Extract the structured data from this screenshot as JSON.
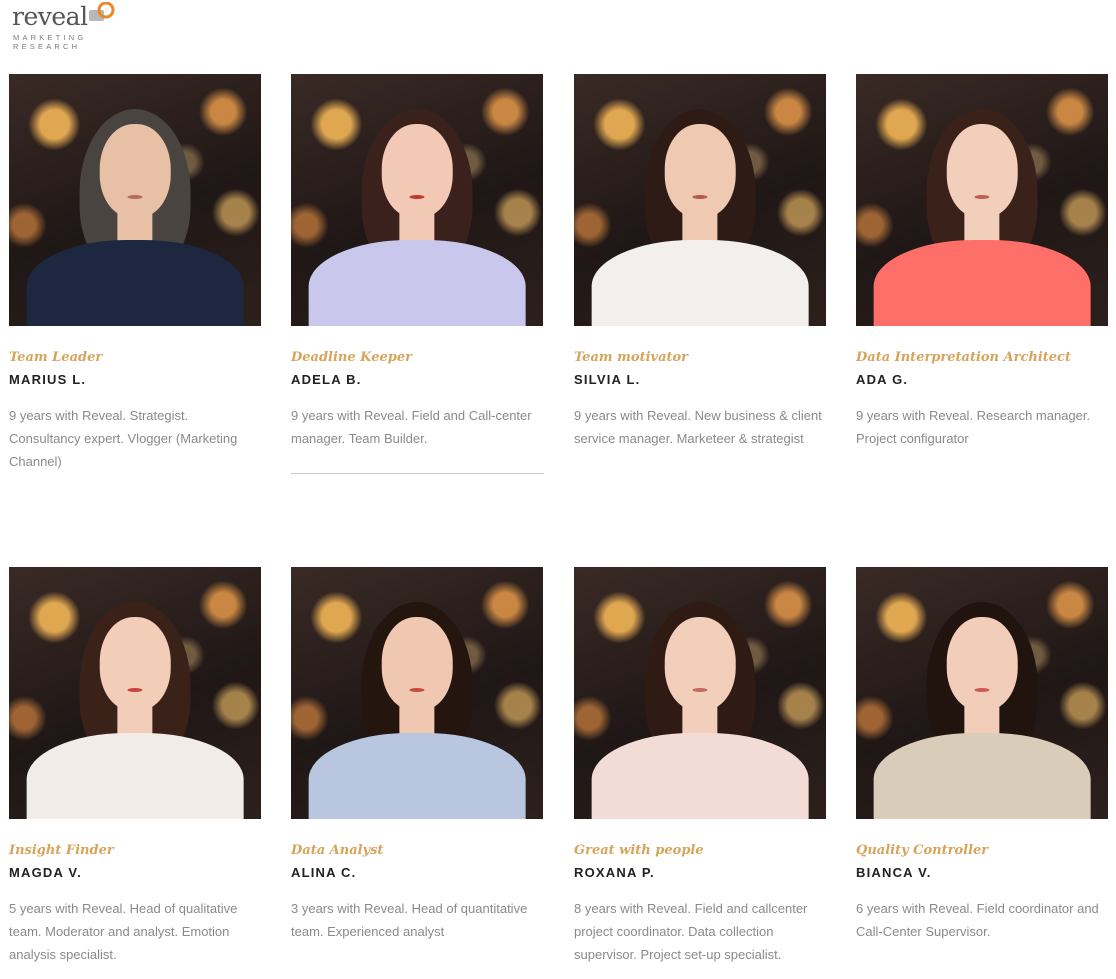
{
  "brand": {
    "name": "reveal",
    "tagline_line1": "MARKETING",
    "tagline_line2": "RESEARCH",
    "accent": "#d7a45b",
    "logo_orange": "#e8892b",
    "logo_grey": "#b8b8b8"
  },
  "team": [
    {
      "role": "Team Leader",
      "name": "MARIUS L.",
      "description": "9 years with Reveal. Strategist. Consultancy expert. Vlogger (Marketing Channel)",
      "photo": {
        "hair": "#4a4440",
        "body": "#1d2740",
        "skin": "#e8c0a6",
        "lips": "#b86b5a"
      }
    },
    {
      "role": "Deadline Keeper",
      "name": "ADELA B.",
      "description": "9 years with Reveal. Field and Call-center manager. Team Builder.",
      "photo": {
        "hair": "#3a211b",
        "body": "#c9c8ec",
        "skin": "#f1c9b4",
        "lips": "#c0392b"
      }
    },
    {
      "role": "Team motivator",
      "name": "SILVIA L.",
      "description": "9 years with Reveal. New business & client service manager. Marketeer & strategist",
      "photo": {
        "hair": "#2e1b15",
        "body": "#f3efec",
        "skin": "#f0c9b3",
        "lips": "#b55a4a"
      }
    },
    {
      "role": "Data Interpretation Architect",
      "name": "ADA G.",
      "description": "9 years with Reveal. Research manager. Project configurator",
      "photo": {
        "hair": "#3a211a",
        "body": "#ff6f6a",
        "skin": "#f2cfba",
        "lips": "#c25c55"
      }
    },
    {
      "role": "Insight Finder",
      "name": "MAGDA V.",
      "description": "5 years with Reveal. Head of qualitative team. Moderator and analyst. Emotion analysis specialist.",
      "photo": {
        "hair": "#3b2219",
        "body": "#f1ece8",
        "skin": "#f2cdb8",
        "lips": "#c8453e"
      }
    },
    {
      "role": "Data Analyst",
      "name": "ALINA C.",
      "description": "3 years with Reveal. Head of quantitative team. Experienced analyst",
      "photo": {
        "hair": "#24160f",
        "body": "#b9c6df",
        "skin": "#f0c8b1",
        "lips": "#c84b3f"
      }
    },
    {
      "role": "Great with people",
      "name": "ROXANA P.",
      "description": "8 years with Reveal. Field and callcenter project coordinator. Data collection supervisor. Project set-up specialist.",
      "photo": {
        "hair": "#2f1a14",
        "body": "#f4dcd6",
        "skin": "#f2cfbb",
        "lips": "#c46a60"
      }
    },
    {
      "role": "Quality Controller",
      "name": "BIANCA V.",
      "description": "6 years with Reveal. Field coordinator and Call-Center Supervisor.",
      "photo": {
        "hair": "#21140f",
        "body": "#d9cdb9",
        "skin": "#f2cdb9",
        "lips": "#c95a55"
      }
    }
  ]
}
